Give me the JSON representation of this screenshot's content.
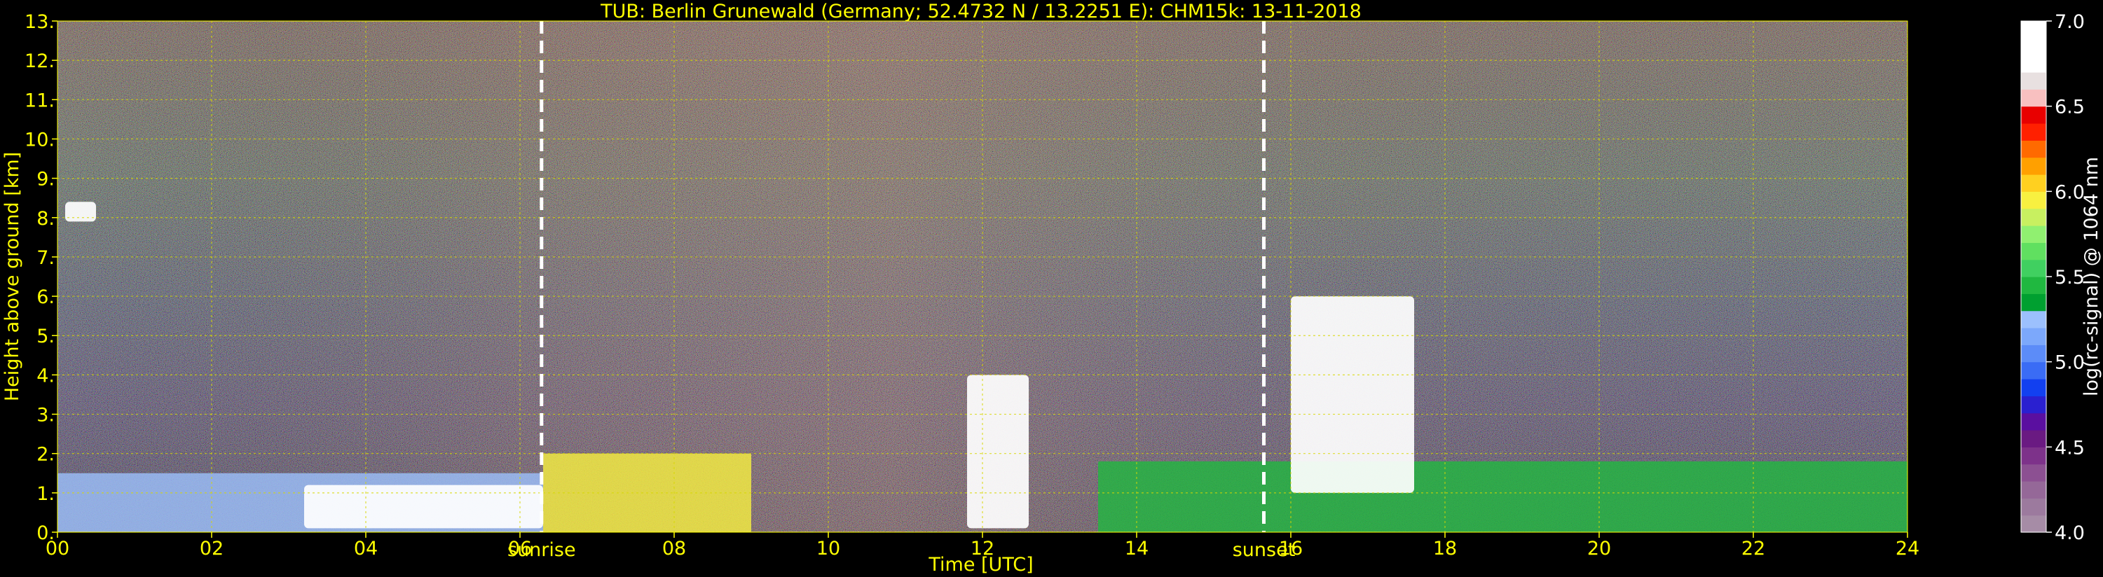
{
  "chart_data": {
    "type": "heatmap",
    "title": "TUB: Berlin Grunewald (Germany; 52.4732 N / 13.2251 E):    CHM15k: 13-11-2018",
    "xlabel": "Time [UTC]",
    "ylabel": "Height above ground [km]",
    "x_ticks": [
      "00",
      "02",
      "04",
      "06",
      "08",
      "10",
      "12",
      "14",
      "16",
      "18",
      "20",
      "22",
      "24"
    ],
    "x_tick_values": [
      0,
      2,
      4,
      6,
      8,
      10,
      12,
      14,
      16,
      18,
      20,
      22,
      24
    ],
    "y_ticks": [
      "0.",
      "1.",
      "2.",
      "3.",
      "4.",
      "5.",
      "6.",
      "7.",
      "8.",
      "9.",
      "10.",
      "11.",
      "12.",
      "13."
    ],
    "y_tick_values": [
      0,
      1,
      2,
      3,
      4,
      5,
      6,
      7,
      8,
      9,
      10,
      11,
      12,
      13
    ],
    "xlim": [
      0,
      24
    ],
    "ylim": [
      0,
      13
    ],
    "grid": true,
    "markers": [
      {
        "label": "sunrise",
        "x": 6.28
      },
      {
        "label": "sunset",
        "x": 15.65
      }
    ],
    "colorbar": {
      "label": "log(rc-signal) @ 1064 nm",
      "range": [
        4.0,
        7.0
      ],
      "ticks": [
        "4.0",
        "4.5",
        "5.0",
        "5.5",
        "6.0",
        "6.5",
        "7.0"
      ],
      "tick_values": [
        4.0,
        4.5,
        5.0,
        5.5,
        6.0,
        6.5,
        7.0
      ],
      "colors": [
        "#a68ca6",
        "#9c7a9e",
        "#956898",
        "#8c5092",
        "#7d328a",
        "#6a1a82",
        "#5a0fa0",
        "#2a20d0",
        "#1240f0",
        "#3a6cf5",
        "#5c8cf8",
        "#7ca8fb",
        "#9cc0fd",
        "#00a030",
        "#20b840",
        "#40d060",
        "#60e060",
        "#90f070",
        "#c8f060",
        "#f8f040",
        "#ffd020",
        "#ffa000",
        "#ff6a00",
        "#ff2000",
        "#e80000",
        "#f8c0c0",
        "#e8e0e0",
        "#ffffff",
        "#ffffff",
        "#ffffff"
      ]
    },
    "colors": {
      "text": "#ffff00",
      "grid": "#d8d800",
      "background": "#000000",
      "marker_line": "#ffffff"
    },
    "features": [
      {
        "kind": "aerosol_layer",
        "x": [
          0.0,
          6.3
        ],
        "y": [
          0.0,
          1.5
        ],
        "level": 5.3
      },
      {
        "kind": "cloud",
        "x": [
          0.1,
          0.5
        ],
        "y": [
          7.9,
          8.4
        ],
        "level": 6.9
      },
      {
        "kind": "cloud",
        "x": [
          3.2,
          6.3
        ],
        "y": [
          0.1,
          1.2
        ],
        "level": 6.9
      },
      {
        "kind": "aerosol_layer",
        "x": [
          6.3,
          9.0
        ],
        "y": [
          0.0,
          2.0
        ],
        "level": 5.9
      },
      {
        "kind": "cloud",
        "x": [
          11.8,
          12.6
        ],
        "y": [
          0.1,
          4.0
        ],
        "level": 6.7
      },
      {
        "kind": "aerosol_layer",
        "x": [
          13.5,
          24.0
        ],
        "y": [
          0.0,
          1.8
        ],
        "level": 5.4
      },
      {
        "kind": "cloud",
        "x": [
          16.0,
          17.6
        ],
        "y": [
          1.0,
          6.0
        ],
        "level": 6.8
      }
    ]
  }
}
